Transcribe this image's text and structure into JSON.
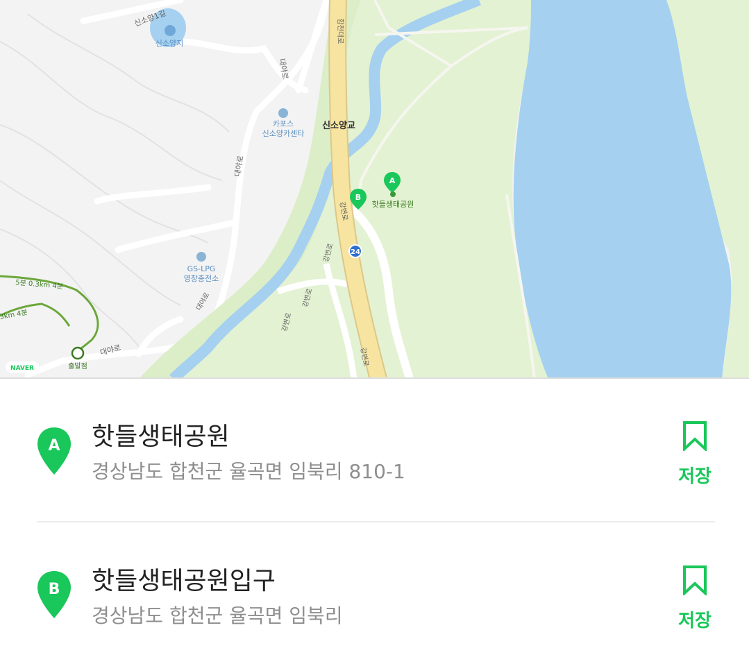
{
  "map": {
    "labels": {
      "reservoir": "신소양지",
      "carpos_1": "카포스",
      "carpos_2": "신소양카센타",
      "bridge": "신소양교",
      "park_poi": "핫들생태공원",
      "gas_1": "GS-LPG",
      "gas_2": "영창충전소",
      "start": "출발점",
      "road_sinsoyang": "신소양1길",
      "road_daeya_1": "대야로",
      "road_daeya_2": "대야로",
      "road_daeya_3": "대야로",
      "road_daeya_4": "대야로",
      "road_hapcheon": "합천대로",
      "road_gangbyeon_1": "강변로",
      "road_gangbyeon_2": "강변로",
      "road_gangbyeon_3": "강변로",
      "road_gangbyeon_4": "강변로",
      "road_gangbyeon_5": "강변로",
      "route_24": "24",
      "trail_1": "5분 0.3km 4분",
      "trail_2": "3km 4분",
      "naver": "NAVER",
      "marker_a": "A",
      "marker_b": "B"
    },
    "colors": {
      "water": "#a5d0f0",
      "park": "#e3f2d2",
      "land": "#f3f3f3",
      "highway": "#f6e4a0",
      "accent": "#19c75a"
    }
  },
  "places": [
    {
      "marker": "A",
      "name": "핫들생태공원",
      "address": "경상남도 합천군 율곡면 임북리 810-1",
      "save_label": "저장",
      "icon": "bookmark-icon"
    },
    {
      "marker": "B",
      "name": "핫들생태공원입구",
      "address": "경상남도 합천군 율곡면 임북리",
      "save_label": "저장",
      "icon": "bookmark-icon"
    }
  ]
}
